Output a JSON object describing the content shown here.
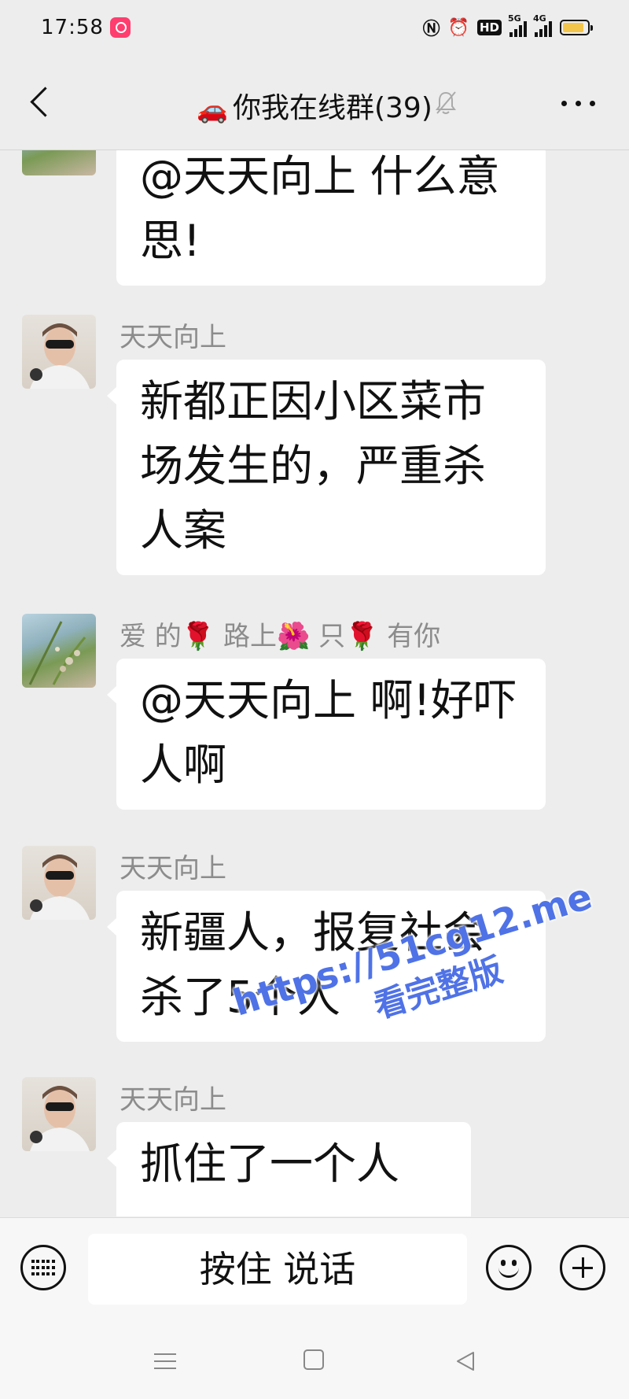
{
  "status_bar": {
    "time": "17:58",
    "icons": [
      "nfc-icon",
      "alarm-icon",
      "hd-icon",
      "5g-signal-icon",
      "4g-signal-icon",
      "battery-icon"
    ],
    "hd_label": "HD",
    "net1": "5G",
    "net2": "4G"
  },
  "header": {
    "title_emoji": "🚗",
    "title": "你我在线群(39)",
    "muted": true
  },
  "messages": [
    {
      "sender": "",
      "avatar": "flower",
      "text": "@天天向上 什么意思!",
      "partial": true
    },
    {
      "sender": "天天向上",
      "avatar": "person",
      "text": "新都正因小区菜市场发生的，严重杀人案"
    },
    {
      "sender": "爱 的🌹 路上🌺 只🌹 有你",
      "avatar": "flower",
      "text": "@天天向上 啊!好吓人啊"
    },
    {
      "sender": "天天向上",
      "avatar": "person",
      "text": "新疆人，报复社会杀了5个人"
    },
    {
      "sender": "天天向上",
      "avatar": "person",
      "text": "抓住了一个人"
    }
  ],
  "watermark": {
    "line1": "https://51cg12.me",
    "line2": "看完整版"
  },
  "input_bar": {
    "talk_label": "按住 说话"
  },
  "colors": {
    "background": "#ededed",
    "bubble": "#ffffff",
    "sender_text": "#8c8c8c",
    "watermark": "#4f72e6",
    "battery": "#f3c64b"
  }
}
